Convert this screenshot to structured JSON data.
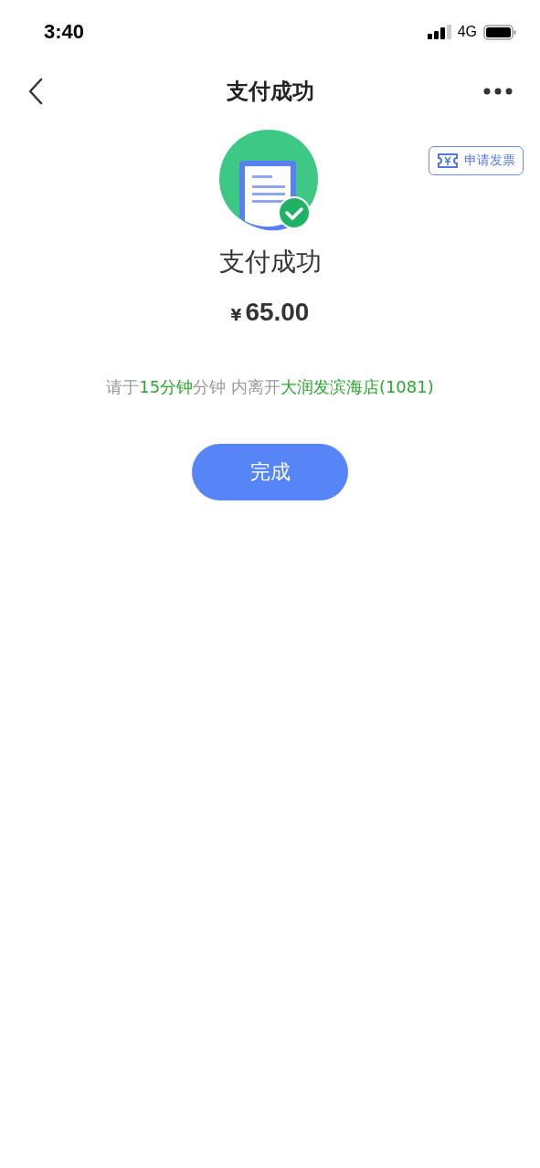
{
  "status_bar": {
    "time": "3:40",
    "network": "4G"
  },
  "nav": {
    "title": "支付成功"
  },
  "invoice_button": {
    "label": "申请发票"
  },
  "result": {
    "title": "支付成功",
    "currency": "¥",
    "amount": "65.00"
  },
  "notice": [
    {
      "text": "请于",
      "highlight": false
    },
    {
      "text": "15分钟",
      "highlight": true
    },
    {
      "text": "分钟 内离开",
      "highlight": false
    },
    {
      "text": "大润发滨海店(1081)",
      "highlight": true
    }
  ],
  "done_button": {
    "label": "完成"
  }
}
